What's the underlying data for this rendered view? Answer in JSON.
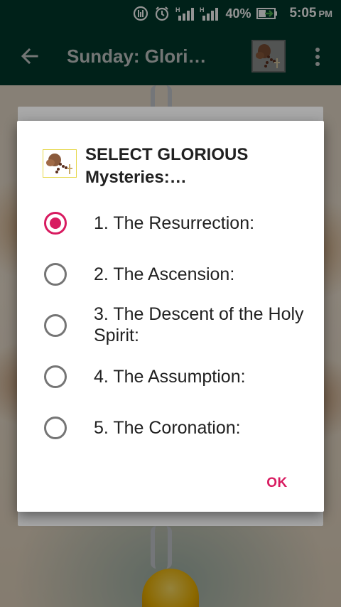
{
  "status_bar": {
    "battery_percent": "40%",
    "time": "5:05",
    "ampm": "PM",
    "icons": [
      "data-saver-icon",
      "alarm-icon",
      "signal-h-icon",
      "signal-h-icon",
      "battery-charging-icon"
    ]
  },
  "app_bar": {
    "title": "Sunday: Glori…",
    "back_icon": "arrow-back-icon",
    "overflow_icon": "more-vert-icon"
  },
  "dialog": {
    "title": "SELECT GLORIOUS Mysteries:…",
    "options": [
      {
        "label": "1.  The Resurrection:",
        "checked": true
      },
      {
        "label": "2.  The Ascension:",
        "checked": false
      },
      {
        "label": "3.  The Descent of the Holy Spirit:",
        "checked": false
      },
      {
        "label": "4.  The Assumption:",
        "checked": false
      },
      {
        "label": "5.  The Coronation:",
        "checked": false
      }
    ],
    "ok_label": "OK"
  },
  "colors": {
    "app_bar": "#00392c",
    "accent": "#d81b60",
    "radio_unchecked": "#757575"
  }
}
